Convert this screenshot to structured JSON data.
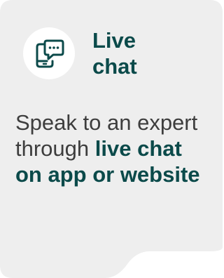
{
  "card": {
    "title": "Live chat",
    "description_plain": "Speak to an expert through",
    "description_bold": "live chat on app or website",
    "icon": "phone-chat-icon",
    "colors": {
      "background": "#eeeeee",
      "accent": "#0b4a4a",
      "text": "#3d3d3d",
      "icon_bg": "#ffffff"
    }
  }
}
